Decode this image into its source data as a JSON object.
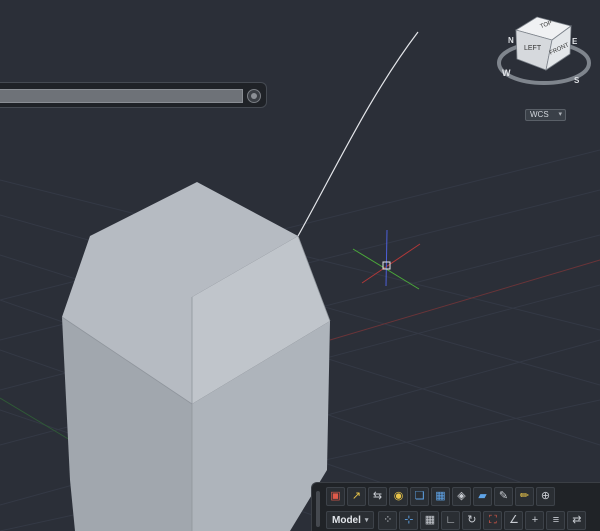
{
  "viewport": {
    "background": "#2b2f38",
    "solid_colors": {
      "top": "#b4b9c0",
      "front": "#aab0b8",
      "left": "#9aa0a7",
      "edge": "#2e3238"
    }
  },
  "viewcube": {
    "faces": {
      "top": "TOP",
      "left": "LEFT",
      "front": "FRONT"
    },
    "compass": {
      "north": "N",
      "east": "E",
      "south": "S",
      "west": "W"
    },
    "ucs_dropdown": {
      "label": "WCS",
      "caret": "▾"
    }
  },
  "command_line": {
    "value": ""
  },
  "status_bar": {
    "row1_icons": [
      {
        "name": "layout-icon",
        "glyph": "▣",
        "tone": "red"
      },
      {
        "name": "snap-draw-icon",
        "glyph": "↗",
        "tone": "yellow"
      },
      {
        "name": "orbit-icon",
        "glyph": "⇆",
        "tone": ""
      },
      {
        "name": "visual-style-icon",
        "glyph": "◉",
        "tone": "yellow",
        "caret": "▾"
      },
      {
        "name": "view-cube-icon",
        "glyph": "❏",
        "tone": "blue",
        "caret": "▾"
      },
      {
        "name": "grid-snap-icon",
        "glyph": "▦",
        "tone": "blue"
      },
      {
        "name": "layers-icon",
        "glyph": "◈",
        "tone": ""
      },
      {
        "name": "plane-icon",
        "glyph": "▰",
        "tone": "blue"
      },
      {
        "name": "pen-icon",
        "glyph": "✎",
        "tone": ""
      },
      {
        "name": "pencil-icon",
        "glyph": "✏",
        "tone": "yellow"
      },
      {
        "name": "navigation-icon",
        "glyph": "⊕",
        "tone": ""
      }
    ],
    "model_button": {
      "label": "Model",
      "caret": "▾"
    },
    "row2_icons": [
      {
        "name": "grid-display-icon",
        "glyph": "⁘",
        "tone": ""
      },
      {
        "name": "snap-mode-icon",
        "glyph": "⊹",
        "tone": "blue"
      },
      {
        "name": "grid-icon",
        "glyph": "▦",
        "tone": ""
      },
      {
        "name": "ortho-icon",
        "glyph": "∟",
        "tone": ""
      },
      {
        "name": "polar-icon",
        "glyph": "↻",
        "tone": ""
      },
      {
        "name": "object-snap-icon",
        "glyph": "⛶",
        "tone": "red"
      },
      {
        "name": "object-tracking-icon",
        "glyph": "∠",
        "tone": ""
      },
      {
        "name": "lineweight-icon",
        "glyph": "+",
        "tone": ""
      },
      {
        "name": "transparency-icon",
        "glyph": "≡",
        "tone": ""
      },
      {
        "name": "selection-cycling-icon",
        "glyph": "⇄",
        "tone": ""
      }
    ]
  }
}
